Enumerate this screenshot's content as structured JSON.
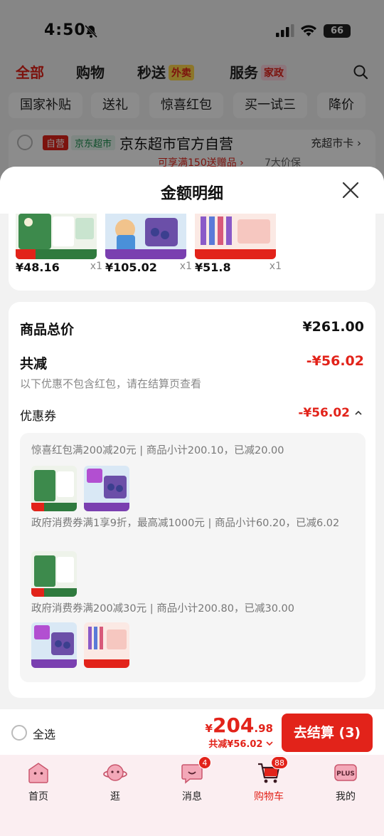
{
  "status_bar": {
    "time": "4:50",
    "battery": "66"
  },
  "top_tabs": [
    {
      "label": "全部",
      "tag": ""
    },
    {
      "label": "购物",
      "tag": ""
    },
    {
      "label": "秒送",
      "tag": "外卖"
    },
    {
      "label": "服务",
      "tag": "家政"
    }
  ],
  "chips": [
    "国家补贴",
    "送礼",
    "惊喜红包",
    "买一试三",
    "降价"
  ],
  "store": {
    "tag_self": "自营",
    "tag_super": "京东超市",
    "name": "京东超市官方自营",
    "card_link": "充超市卡 ›",
    "promo": "可享满150送赠品 ›",
    "promo2": "7大价保"
  },
  "sheet": {
    "title": "金额明细",
    "items": [
      {
        "price": "¥48.16",
        "qty": "x1"
      },
      {
        "price": "¥105.02",
        "qty": "x1"
      },
      {
        "price": "¥51.8",
        "qty": "x1"
      }
    ],
    "total_label": "商品总价",
    "total_value": "¥261.00",
    "minus_label": "共减",
    "minus_value": "-¥56.02",
    "note": "以下优惠不包含红包，请在结算页查看",
    "coupon_label": "优惠券",
    "coupon_value": "-¥56.02",
    "coupons": [
      {
        "text": "惊喜红包满200减20元 | 商品小计200.10，已减20.00"
      },
      {
        "text": "政府消费券满1享9折，最高减1000元 | 商品小计60.20，已减6.02"
      },
      {
        "text": "政府消费券满200减30元 | 商品小计200.80，已减30.00"
      }
    ]
  },
  "checkout": {
    "select_all": "全选",
    "price_currency": "¥",
    "price_int": "204",
    "price_dec": ".98",
    "saved": "共减¥56.02",
    "button": "去结算 (3)"
  },
  "tab_bar": [
    {
      "label": "首页",
      "icon": "home-icon",
      "badge": ""
    },
    {
      "label": "逛",
      "icon": "planet-icon",
      "badge": ""
    },
    {
      "label": "消息",
      "icon": "message-icon",
      "badge": "4"
    },
    {
      "label": "购物车",
      "icon": "cart-icon",
      "badge": "88"
    },
    {
      "label": "我的",
      "icon": "plus-icon",
      "badge": ""
    }
  ],
  "colors": {
    "accent": "#e2231a",
    "sheet_bg": "#f2f2f2",
    "tabbar_bg": "#fbeef1"
  }
}
